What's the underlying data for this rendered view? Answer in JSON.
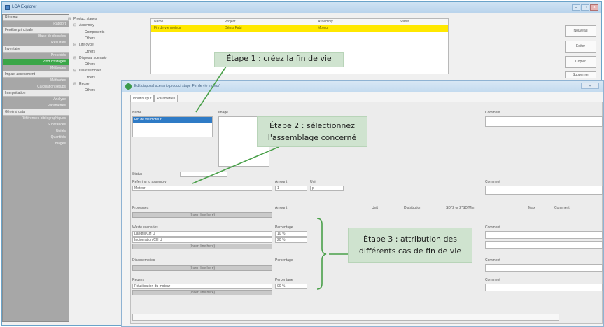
{
  "window": {
    "title": "LCA Explorer"
  },
  "nav": [
    {
      "type": "grp",
      "label": "Résumé"
    },
    {
      "type": "item",
      "label": "Rapport"
    },
    {
      "type": "grp",
      "label": "Fenêtre principale"
    },
    {
      "type": "item",
      "label": "Base de données"
    },
    {
      "type": "item",
      "label": "Résultats"
    },
    {
      "type": "grp",
      "label": "Inventaire"
    },
    {
      "type": "item",
      "label": "Procédés"
    },
    {
      "type": "item",
      "label": "Product stages",
      "active": true
    },
    {
      "type": "item",
      "label": "Méthodes"
    },
    {
      "type": "grp",
      "label": "Impact assessment"
    },
    {
      "type": "item",
      "label": "Méthodes"
    },
    {
      "type": "item",
      "label": "Calculation setups"
    },
    {
      "type": "grp",
      "label": "Interprétation"
    },
    {
      "type": "item",
      "label": "Analyse"
    },
    {
      "type": "item",
      "label": "Paramètres"
    },
    {
      "type": "grp",
      "label": "Général data"
    },
    {
      "type": "item",
      "label": "Références bibliographiques"
    },
    {
      "type": "item",
      "label": "Substances"
    },
    {
      "type": "item",
      "label": "Unités"
    },
    {
      "type": "item",
      "label": "Quantités"
    },
    {
      "type": "item",
      "label": "Images"
    }
  ],
  "tree": [
    {
      "label": "Product stages",
      "indent": 0
    },
    {
      "label": "Assembly",
      "indent": 1
    },
    {
      "label": "Components",
      "indent": 2
    },
    {
      "label": "Others",
      "indent": 2
    },
    {
      "label": "Life cycle",
      "indent": 1
    },
    {
      "label": "Others",
      "indent": 2
    },
    {
      "label": "Disposal scenario",
      "indent": 1
    },
    {
      "label": "Others",
      "indent": 2
    },
    {
      "label": "Disassemblies",
      "indent": 1
    },
    {
      "label": "Others",
      "indent": 2
    },
    {
      "label": "Reuse",
      "indent": 1
    },
    {
      "label": "Others",
      "indent": 2
    }
  ],
  "table": {
    "headers": [
      "Name",
      "Project",
      "Assembly",
      "Status"
    ],
    "row": [
      "Fin de vie moteur",
      "Démo Fabi",
      "Moteur",
      ""
    ]
  },
  "buttons": [
    "Nouveau",
    "Editer",
    "Copier",
    "Supprimer"
  ],
  "dialog": {
    "title": "Edit disposal scenario product stage 'Fin de vie moteur'",
    "close": "✕",
    "tabs": [
      "Input/output",
      "Paramètres"
    ],
    "name_label": "Name",
    "name_value": "Fin de vie moteur",
    "image_label": "Image",
    "comment_label": "Comment",
    "status_label": "Status",
    "ref_label": "Referring to assembly",
    "amount_label": "Amount",
    "unit_label": "Unit",
    "ref_value": "Moteur",
    "amount_value": "1",
    "unit_value": "p",
    "processes_label": "Processes",
    "cols": [
      "Amount",
      "Unit",
      "Distribution",
      "SD^2 or 2*SD/Min",
      "Max",
      "Comment"
    ],
    "insert_line": "(Insert line here)",
    "waste_label": "Waste scenarios",
    "percentage_label": "Percentage",
    "waste_rows": [
      {
        "name": "Landfill/CH U",
        "pct": "10 %"
      },
      {
        "name": "Incineration/CH U",
        "pct": "20 %"
      }
    ],
    "disassembly_label": "Disassemblies",
    "reuse_label": "Reuses",
    "reuse_rows": [
      {
        "name": "Réutilisation du moteur",
        "pct": "90 %"
      }
    ]
  },
  "callouts": {
    "step1": "Étape 1 : créez la fin de vie",
    "step2a": "Étape 2 : sélectionnez",
    "step2b": "l'assemblage concerné",
    "step3a": "Étape 3 : attribution des",
    "step3b": "différents cas de fin de vie"
  },
  "colors": {
    "accent_green": "#3aa648",
    "highlight_yellow": "#ffe800",
    "callout_bg": "#cfe3cf",
    "arrow_green": "#4aa04a"
  }
}
